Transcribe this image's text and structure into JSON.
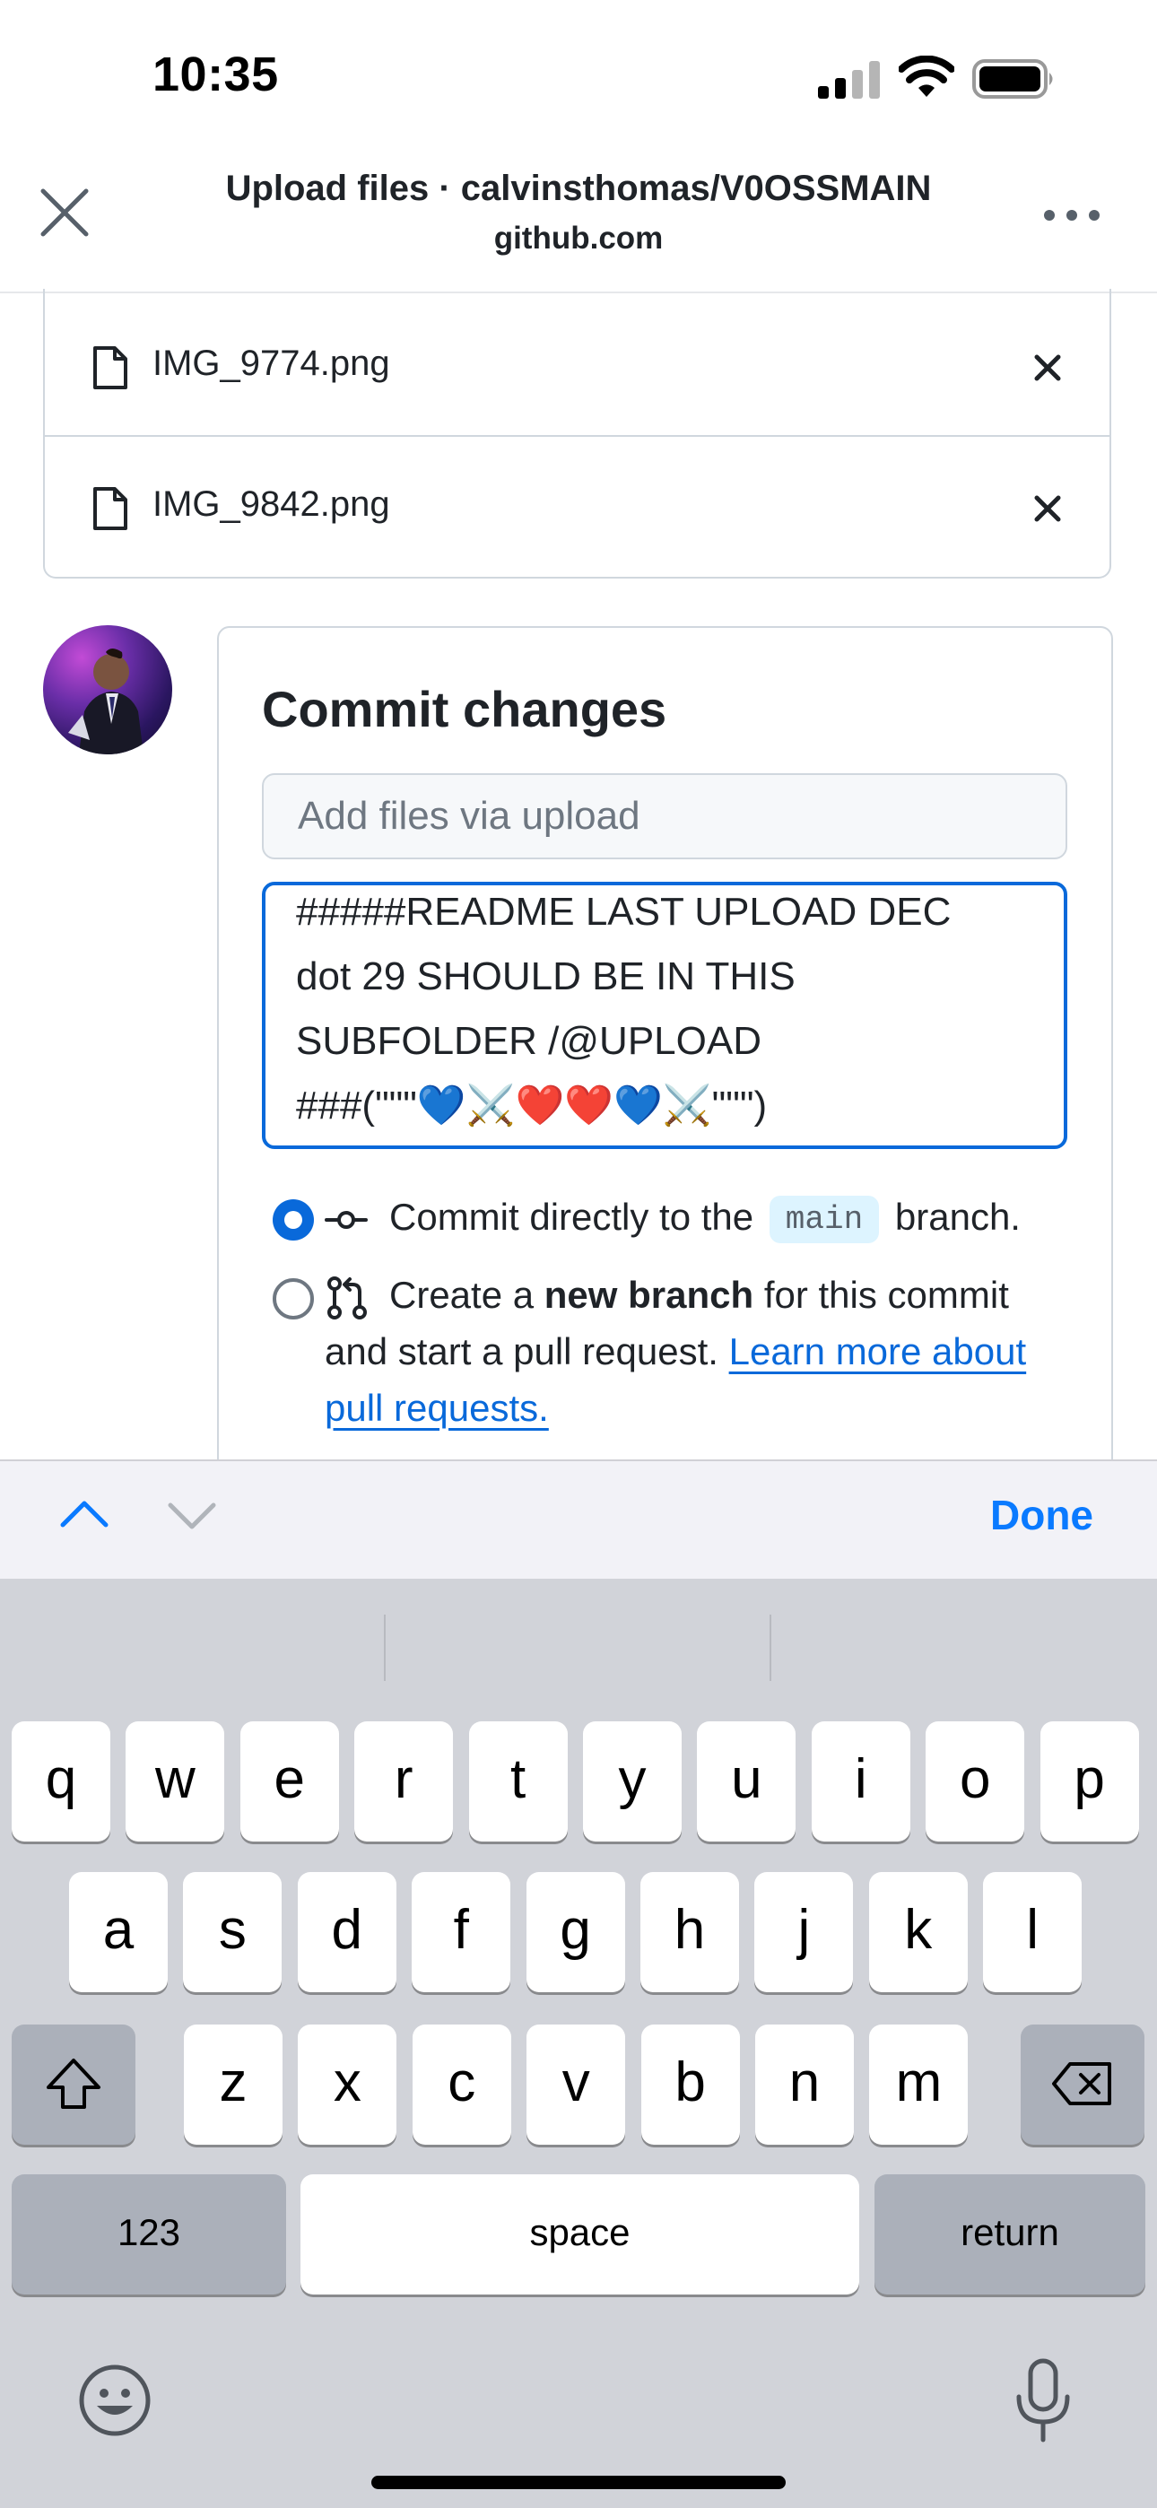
{
  "status_bar": {
    "time": "10:35"
  },
  "header": {
    "title": "Upload files · calvinsthomas/V0OSSMAIN",
    "subtitle": "github.com"
  },
  "files": [
    {
      "name": "IMG_9774.png"
    },
    {
      "name": "IMG_9842.png"
    }
  ],
  "commit": {
    "title": "Commit changes",
    "summary_placeholder": "Add files via upload",
    "description_value": "#####README LAST UPLOAD DEC\ndot 29 SHOULD BE IN THIS\nSUBFOLDER /@UPLOAD\n###(\"\"\"💙⚔️❤️❤️💙⚔️\"\"\")",
    "option_direct": {
      "prefix": "Commit directly to the",
      "branch": "main",
      "suffix": "branch.",
      "selected": true
    },
    "option_new_branch": {
      "prefix": "Create a",
      "bold": "new branch",
      "suffix": "for this commit",
      "line2": "and start a pull request.",
      "link_part1": "Learn more about",
      "link_part2": "pull requests.",
      "selected": false
    }
  },
  "accessory_bar": {
    "done_label": "Done"
  },
  "keyboard": {
    "row1": [
      "q",
      "w",
      "e",
      "r",
      "t",
      "y",
      "u",
      "i",
      "o",
      "p"
    ],
    "row2": [
      "a",
      "s",
      "d",
      "f",
      "g",
      "h",
      "j",
      "k",
      "l"
    ],
    "row3": [
      "z",
      "x",
      "c",
      "v",
      "b",
      "n",
      "m"
    ],
    "numbers_label": "123",
    "space_label": "space",
    "return_label": "return"
  },
  "colors": {
    "accent": "#0969da",
    "done_blue": "#0a7aff",
    "keyboard_bg": "#d1d3d9",
    "border": "#d0d7de"
  }
}
